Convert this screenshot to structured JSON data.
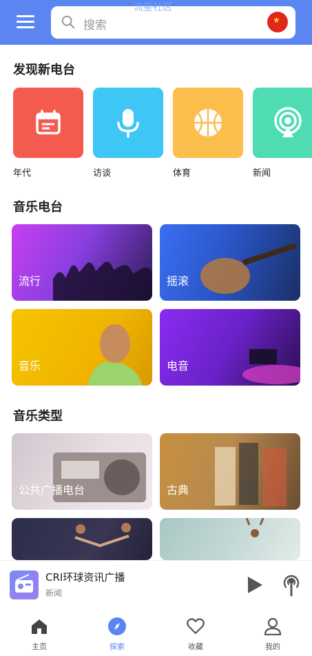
{
  "header": {
    "menu_icon": "menu-icon",
    "search_placeholder": "搜索",
    "overlay_text": "流星社区",
    "flag_icon": "china-flag-icon"
  },
  "discover": {
    "title": "发现新电台",
    "items": [
      {
        "label": "年代",
        "icon": "calendar-icon",
        "color": "#f45b4f"
      },
      {
        "label": "访谈",
        "icon": "microphone-icon",
        "color": "#3ec6f4"
      },
      {
        "label": "体育",
        "icon": "basketball-icon",
        "color": "#fbbd4b"
      },
      {
        "label": "新闻",
        "icon": "broadcast-icon",
        "color": "#4fdcb3"
      }
    ]
  },
  "music_radio": {
    "title": "音乐电台",
    "tiles": [
      {
        "label": "流行"
      },
      {
        "label": "摇滚"
      },
      {
        "label": "音乐"
      },
      {
        "label": "电音"
      }
    ]
  },
  "music_types": {
    "title": "音乐类型",
    "tiles": [
      {
        "label": "公共广播电台"
      },
      {
        "label": "古典"
      },
      {
        "label": ""
      },
      {
        "label": ""
      }
    ]
  },
  "player": {
    "title": "CRI环球资讯广播",
    "subtitle": "新闻",
    "play_icon": "play-icon",
    "podcast_icon": "podcast-icon"
  },
  "tabs": [
    {
      "label": "主页",
      "icon": "home-icon",
      "active": false
    },
    {
      "label": "探索",
      "icon": "compass-icon",
      "active": true
    },
    {
      "label": "收藏",
      "icon": "heart-icon",
      "active": false
    },
    {
      "label": "我的",
      "icon": "user-icon",
      "active": false
    }
  ],
  "colors": {
    "accent": "#5b86f2",
    "active_tab": "#5b86f2"
  }
}
